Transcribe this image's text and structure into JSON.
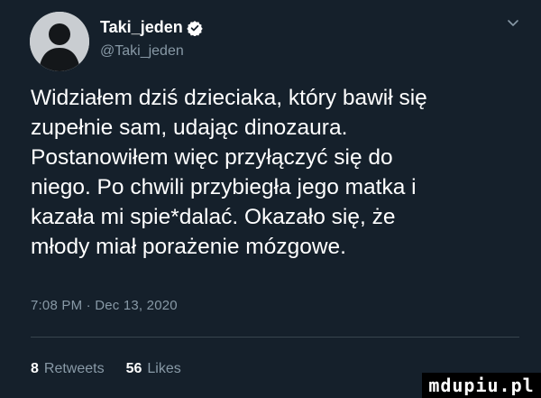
{
  "user": {
    "display_name": "Taki_jeden",
    "handle": "@Taki_jeden",
    "verified": true
  },
  "tweet": {
    "lines": [
      "Widziałem dziś dzieciaka, który bawił się",
      "zupełnie sam, udając dinozaura.",
      "Postanowiłem więc przyłączyć się do",
      "niego. Po chwili przybiegła jego matka i",
      "kazała mi spie*dalać. Okazało się, że",
      "młody miał porażenie mózgowe."
    ],
    "timestamp": "7:08 PM · Dec 13, 2020"
  },
  "stats": {
    "retweets_count": "8",
    "retweets_label": "Retweets",
    "likes_count": "56",
    "likes_label": "Likes"
  },
  "icons": {
    "avatar": "default-avatar-icon",
    "verified": "verified-badge-icon",
    "menu": "chevron-down-icon"
  },
  "colors": {
    "background": "#15202b",
    "text_primary": "#ffffff",
    "text_secondary": "#8899a6",
    "divider": "#38444d",
    "verified": "#ffffff"
  },
  "watermark": {
    "text": "mdupiu.pl"
  }
}
